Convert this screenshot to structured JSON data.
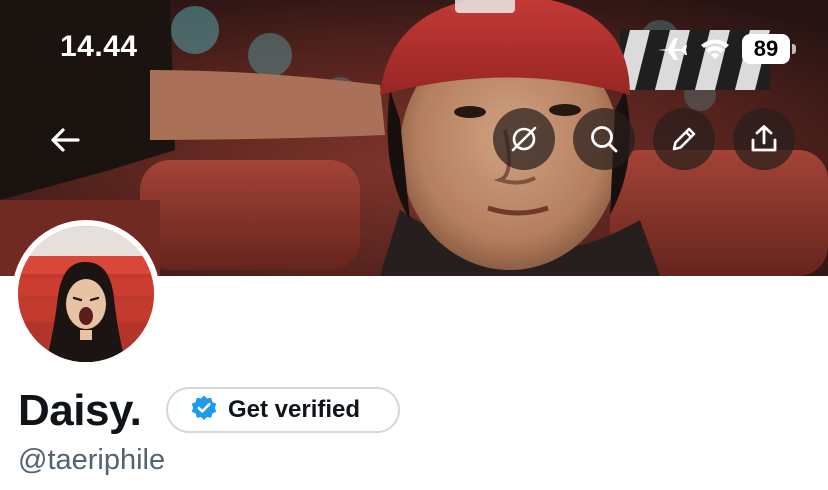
{
  "status_bar": {
    "time": "14.44",
    "battery": "89",
    "icons": [
      "airplane-icon",
      "wifi-icon",
      "battery-icon"
    ]
  },
  "nav": {
    "back_icon": "arrow-left-icon",
    "actions": [
      {
        "name": "grok-icon"
      },
      {
        "name": "search-icon"
      },
      {
        "name": "edit-icon"
      },
      {
        "name": "share-icon"
      }
    ]
  },
  "profile": {
    "display_name": "Daisy.",
    "handle": "@taeriphile",
    "verify_label": "Get verified",
    "verify_icon": "verified-badge-icon"
  },
  "colors": {
    "verified_blue": "#1d9bf0",
    "text_primary": "#0f1419",
    "text_secondary": "#536471",
    "border": "#cfd9de"
  }
}
